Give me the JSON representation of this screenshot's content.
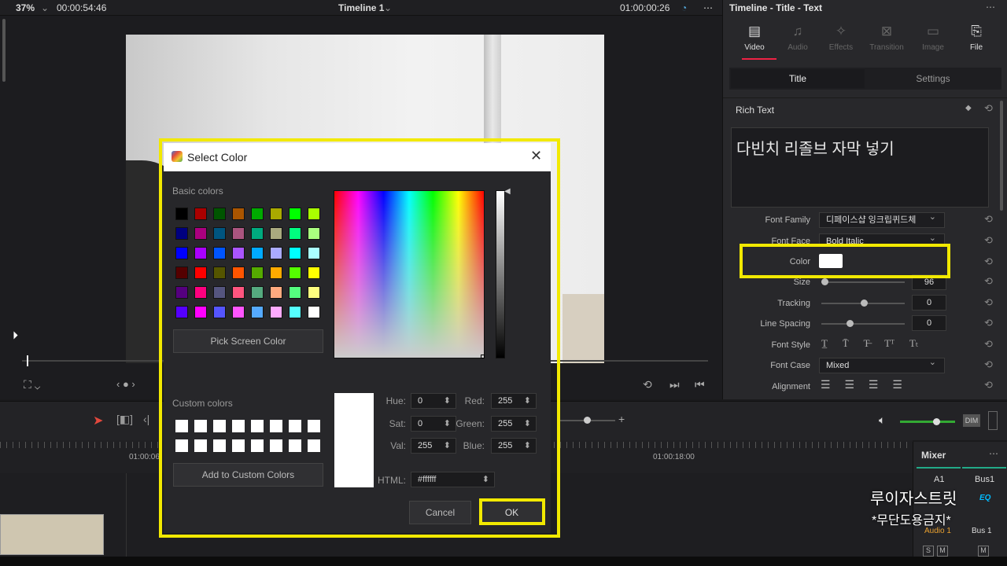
{
  "topbar": {
    "zoom": "37%",
    "timecode_left": "00:00:54:46",
    "timeline_name": "Timeline 1",
    "timecode_right": "01:00:00:26"
  },
  "inspector": {
    "title": "Timeline - Title - Text",
    "tabs": [
      {
        "label": "Video",
        "icon": "film-icon"
      },
      {
        "label": "Audio",
        "icon": "music-icon"
      },
      {
        "label": "Effects",
        "icon": "wand-icon"
      },
      {
        "label": "Transition",
        "icon": "transition-icon"
      },
      {
        "label": "Image",
        "icon": "image-icon"
      },
      {
        "label": "File",
        "icon": "file-icon"
      }
    ],
    "segments": [
      "Title",
      "Settings"
    ],
    "rich_text_label": "Rich Text",
    "rich_text_value": "다빈치 리졸브 자막 넣기",
    "rows": {
      "font_family": {
        "label": "Font Family",
        "value": "디페이스샵 잉크립퀴드체"
      },
      "font_face": {
        "label": "Font Face",
        "value": "Bold Italic"
      },
      "color": {
        "label": "Color",
        "value": "#ffffff"
      },
      "size": {
        "label": "Size",
        "value": "96"
      },
      "tracking": {
        "label": "Tracking",
        "value": "0"
      },
      "line_spacing": {
        "label": "Line Spacing",
        "value": "0"
      },
      "font_style": {
        "label": "Font Style"
      },
      "font_case": {
        "label": "Font Case",
        "value": "Mixed"
      },
      "alignment": {
        "label": "Alignment"
      }
    }
  },
  "timeline": {
    "ruler_labels": [
      "01:00:06",
      "01:00:18:00"
    ],
    "dim_label": "DIM"
  },
  "mixer": {
    "title": "Mixer",
    "cols": [
      "A1",
      "Bus1"
    ],
    "eq_label": "EQ",
    "track_label": "Audio 1",
    "bus_label": "Bus 1",
    "s_label": "S",
    "m_label": "M"
  },
  "dialog": {
    "title": "Select Color",
    "basic_colors_label": "Basic colors",
    "basic_colors": [
      [
        "#000000",
        "#aa0000",
        "#005500",
        "#aa5500",
        "#00aa00",
        "#aaaa00",
        "#00ff00",
        "#aaff00"
      ],
      [
        "#00007f",
        "#aa007f",
        "#00557f",
        "#aa557f",
        "#00aa7f",
        "#aaaa7f",
        "#00ff7f",
        "#aaff7f"
      ],
      [
        "#0000ff",
        "#aa00ff",
        "#0055ff",
        "#aa55ff",
        "#00aaff",
        "#aaaaff",
        "#00ffff",
        "#aaffff"
      ],
      [
        "#550000",
        "#ff0000",
        "#555500",
        "#ff5500",
        "#55aa00",
        "#ffaa00",
        "#55ff00",
        "#ffff00"
      ],
      [
        "#55007f",
        "#ff007f",
        "#55557f",
        "#ff557f",
        "#55aa7f",
        "#ffaa7f",
        "#55ff7f",
        "#ffff7f"
      ],
      [
        "#5500ff",
        "#ff00ff",
        "#5555ff",
        "#ff55ff",
        "#55aaff",
        "#ffaaff",
        "#55ffff",
        "#ffffff"
      ]
    ],
    "pick_screen_label": "Pick Screen Color",
    "custom_colors_label": "Custom colors",
    "add_custom_label": "Add to Custom Colors",
    "fields": {
      "hue": {
        "label": "Hue:",
        "value": "0"
      },
      "sat": {
        "label": "Sat:",
        "value": "0"
      },
      "val": {
        "label": "Val:",
        "value": "255"
      },
      "red": {
        "label": "Red:",
        "value": "255"
      },
      "green": {
        "label": "Green:",
        "value": "255"
      },
      "blue": {
        "label": "Blue:",
        "value": "255"
      },
      "html": {
        "label": "HTML:",
        "value": "#ffffff"
      }
    },
    "cancel_label": "Cancel",
    "ok_label": "OK",
    "preview_color": "#ffffff"
  },
  "watermark": {
    "line1": "루이자스트릿",
    "line2": "*무단도용금지*"
  },
  "highlight_color": "#f2e900"
}
